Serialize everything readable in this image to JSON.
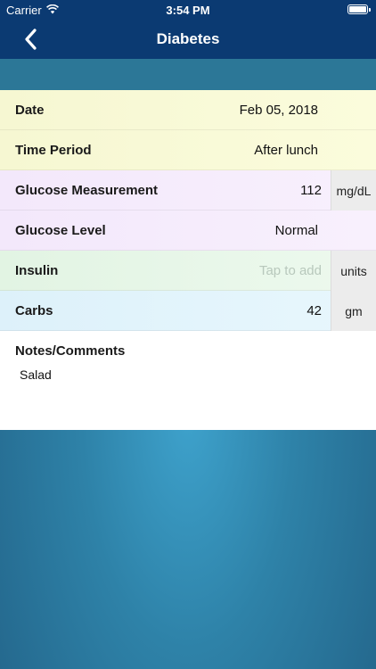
{
  "status_bar": {
    "carrier": "Carrier",
    "time": "3:54 PM"
  },
  "nav": {
    "title": "Diabetes",
    "back_icon": "chevron-left-icon"
  },
  "form": {
    "date": {
      "label": "Date",
      "value": "Feb 05, 2018"
    },
    "time_period": {
      "label": "Time Period",
      "value": "After lunch"
    },
    "glucose_measurement": {
      "label": "Glucose Measurement",
      "value": "112",
      "unit": "mg/dL"
    },
    "glucose_level": {
      "label": "Glucose Level",
      "value": "Normal"
    },
    "insulin": {
      "label": "Insulin",
      "placeholder": "Tap to add",
      "unit": "units"
    },
    "carbs": {
      "label": "Carbs",
      "value": "42",
      "unit": "gm"
    },
    "notes": {
      "label": "Notes/Comments",
      "value": "Salad"
    }
  },
  "colors": {
    "nav_bg": "#0b3a72",
    "yellow_row": "#f8f9d6",
    "pink_row": "#f5ebfc",
    "green_row": "#e6f6e7",
    "cyan_row": "#e1f3fb",
    "background": "#2e82a8"
  }
}
